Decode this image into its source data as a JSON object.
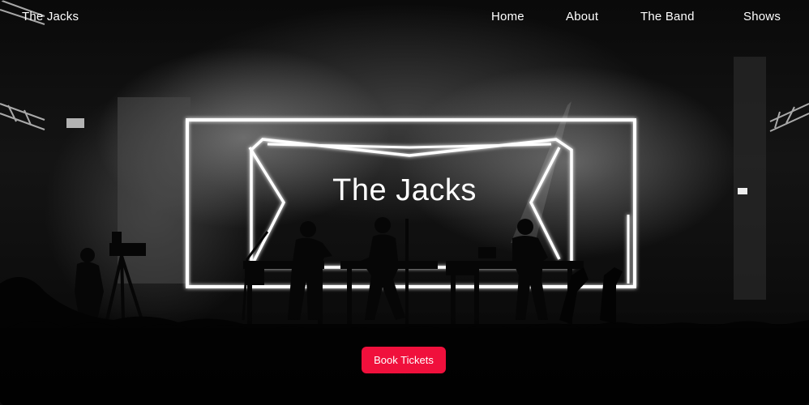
{
  "nav": {
    "brand": "The Jacks",
    "links": [
      {
        "label": "Home"
      },
      {
        "label": "About"
      },
      {
        "label": "The Band"
      },
      {
        "label": "Shows"
      }
    ]
  },
  "hero": {
    "title": "The Jacks",
    "cta_label": "Book Tickets"
  },
  "colors": {
    "accent": "#f0103c",
    "text": "#ffffff",
    "background": "#0b0b0b"
  }
}
